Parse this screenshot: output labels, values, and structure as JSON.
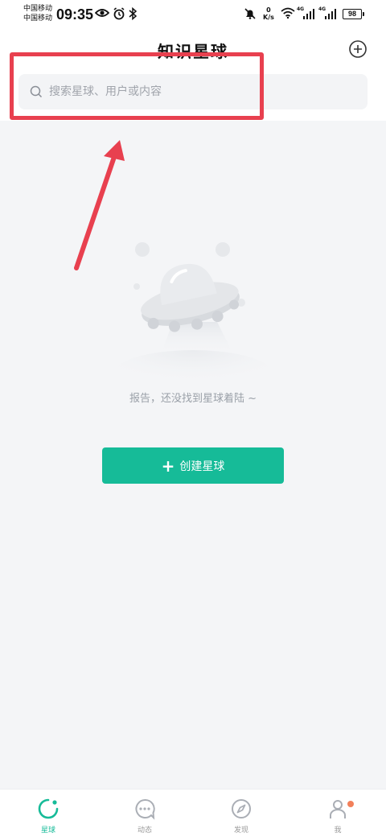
{
  "status_bar": {
    "carrier_1": "中国移动",
    "carrier_2": "中国移动",
    "time": "09:35",
    "net_speed_value": "0",
    "net_speed_unit": "K/s",
    "signal_1_label": "4G",
    "signal_2_label": "4G",
    "battery": "98"
  },
  "header": {
    "title": "知识星球",
    "add_icon": "plus-circle-icon"
  },
  "search": {
    "placeholder": "搜索星球、用户或内容",
    "icon": "search-icon"
  },
  "empty_state": {
    "message": "报告，还没找到星球着陆 ~",
    "create_button_label": "创建星球"
  },
  "bottom_nav": {
    "items": [
      {
        "label": "星球",
        "icon": "planet-icon",
        "active": true
      },
      {
        "label": "动态",
        "icon": "chat-bubble-icon",
        "active": false
      },
      {
        "label": "发现",
        "icon": "compass-icon",
        "active": false
      },
      {
        "label": "我",
        "icon": "user-icon",
        "active": false,
        "badge": true
      }
    ]
  },
  "colors": {
    "accent": "#16bb98",
    "annotation": "#e8404f",
    "badge": "#f2805a",
    "background": "#f4f5f7"
  }
}
